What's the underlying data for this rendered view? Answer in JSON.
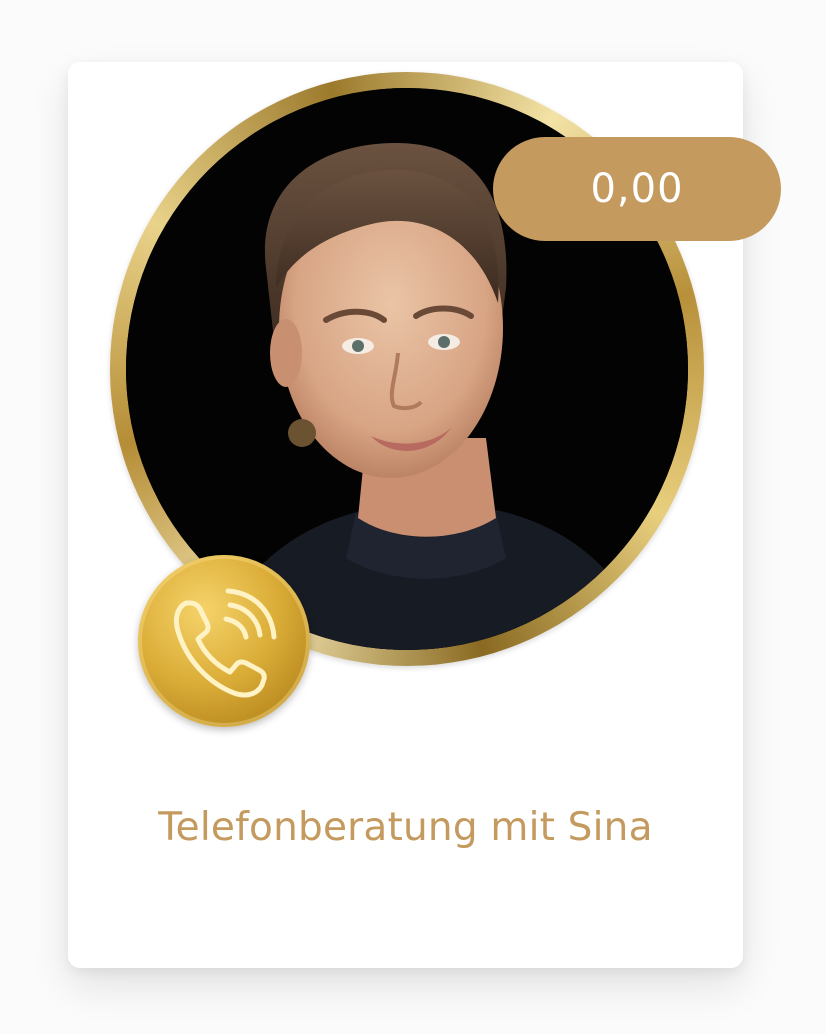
{
  "product": {
    "price": "0,00",
    "title": "Telefonberatung mit Sina"
  },
  "icons": {
    "phone": "phone-call-icon"
  },
  "colors": {
    "accent": "#c49a5f",
    "gold": "#d4a93a",
    "portrait_bg": "#030303"
  }
}
